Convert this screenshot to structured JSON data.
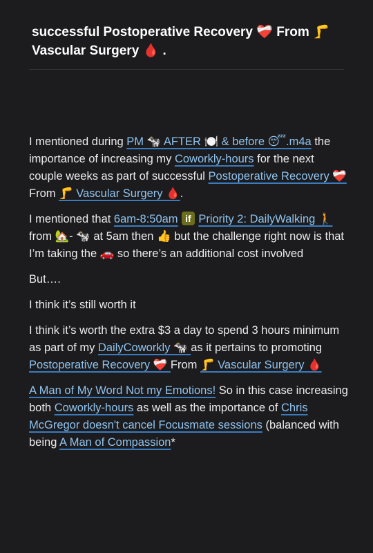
{
  "note": {
    "title": {
      "t1": "successful Postoperative Recovery ",
      "e1": "❤️‍🩹",
      "t2": "  From ",
      "e2": "🦵",
      "t3": " Vascular Surgery ",
      "e3": "🩸",
      "t4": " ."
    },
    "p1": {
      "t1": "I mentioned during ",
      "l1": "PM 🐄 AFTER 🍽️ & before 😴.m4a",
      "t2": " the importance of increasing my ",
      "l2": "Coworkly-hours",
      "t3": " for the next couple weeks as part of successful ",
      "l3": "Postoperative Recovery ❤️‍🩹 ",
      "t4": " From ",
      "l4": "🦵 Vascular Surgery 🩸",
      "t5": "."
    },
    "p2": {
      "t1": "I mentioned that ",
      "l1": "6am-8:50am",
      "badge": "if",
      "l2": "Priority 2: DailyWalking 🚶",
      "t2": " from 🏡- 🐄 at 5am then 👍 but the challenge right now is that I’m taking the 🚗 so there’s an additional cost involved"
    },
    "p3": "But….",
    "p4": "I think it’s still worth it",
    "p5": {
      "t1": "I think it’s worth the extra $3 a day to spend 3 hours minimum as part of my ",
      "l1": "DailyCoworkly 🐄 ",
      "t2": " as it pertains to promoting ",
      "l2": " Postoperative Recovery ❤️‍🩹 ",
      "t3": " From ",
      "l3": "🦵 Vascular Surgery 🩸"
    },
    "p6": {
      "l1": "A Man of My Word Not my Emotions!",
      "t1": " So in this case increasing both ",
      "l2": "Coworkly-hours",
      "t2": " as well as the importance of ",
      "l3": "Chris McGregor doesn't cancel Focusmate sessions",
      "t3": " (balanced with being ",
      "l4": "A Man of Compassion",
      "t4": "*"
    }
  }
}
